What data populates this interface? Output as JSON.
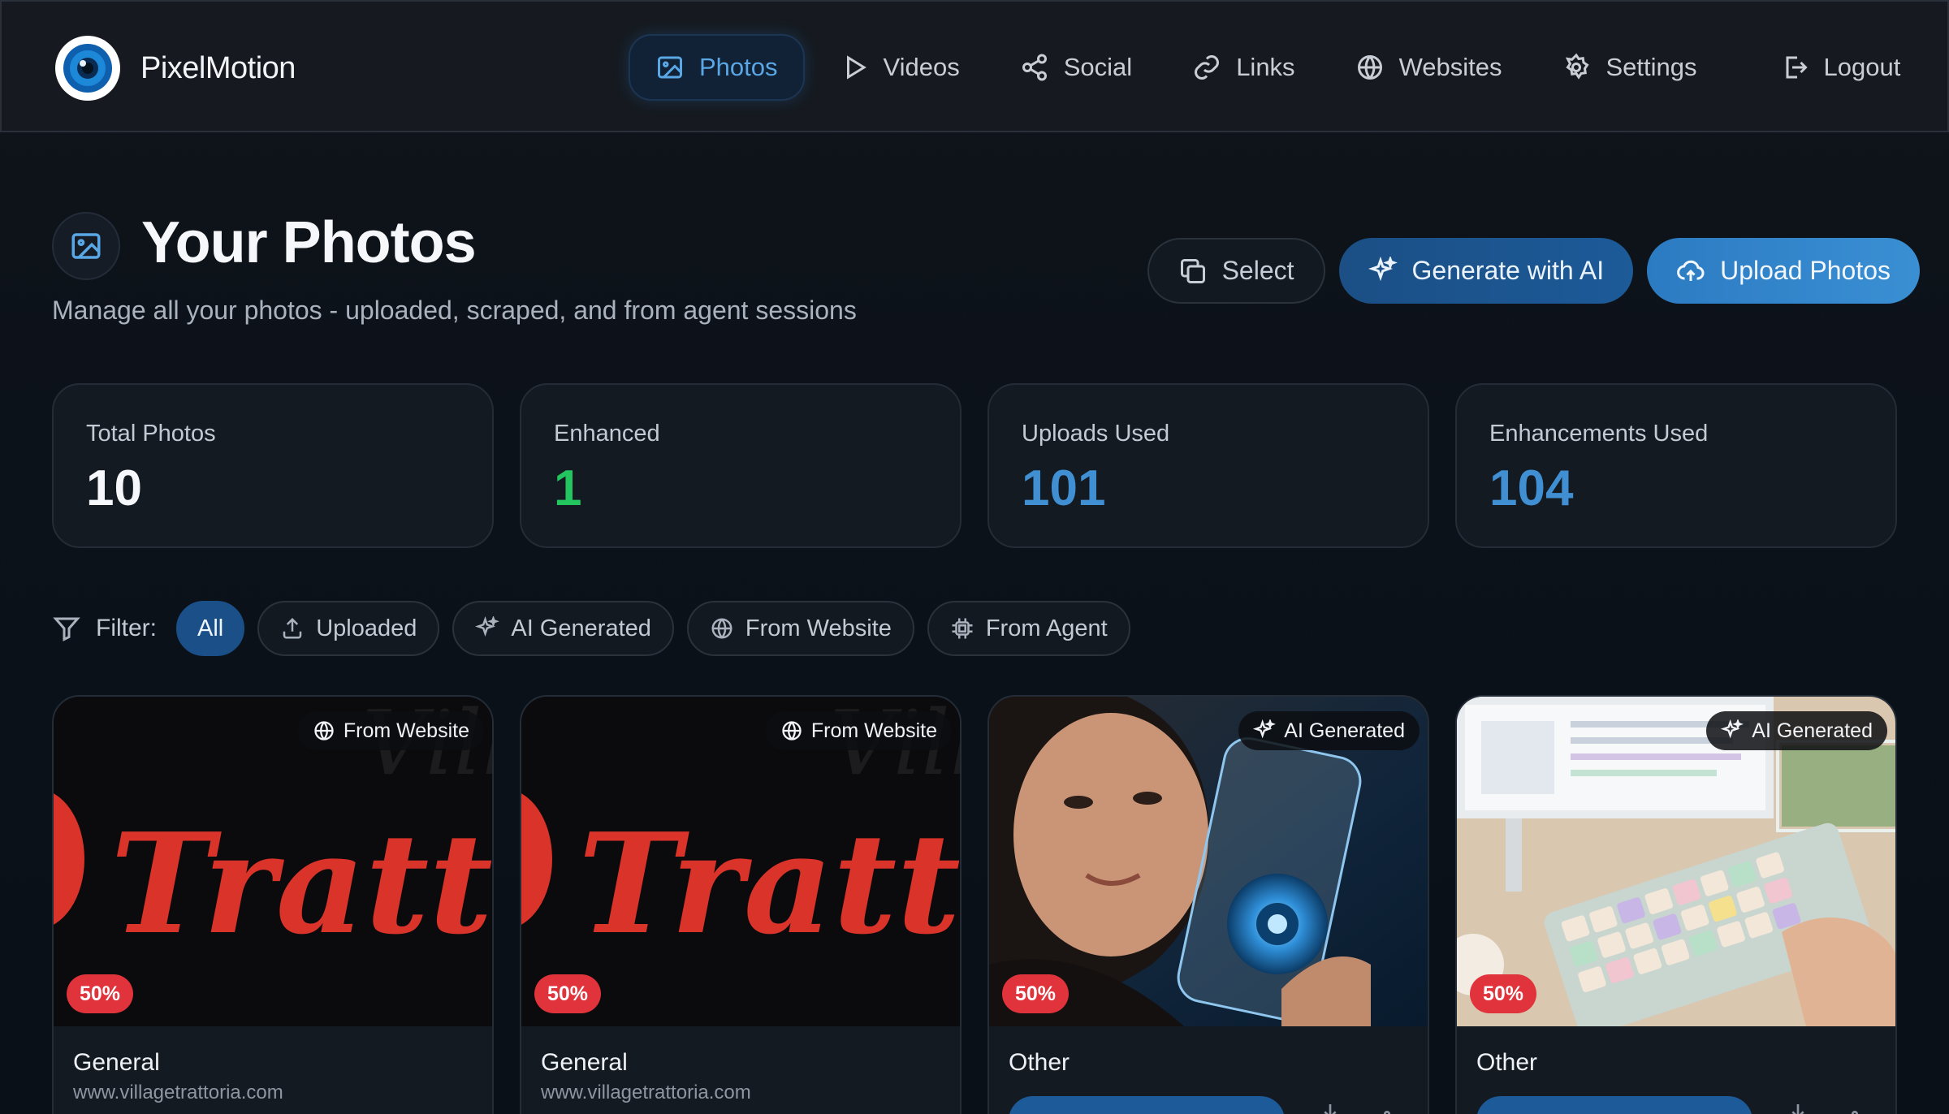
{
  "app": {
    "name": "PixelMotion"
  },
  "nav": {
    "items": [
      {
        "label": "Photos",
        "icon": "image-icon",
        "active": true
      },
      {
        "label": "Videos",
        "icon": "play-icon"
      },
      {
        "label": "Social",
        "icon": "share-icon"
      },
      {
        "label": "Links",
        "icon": "link-icon"
      },
      {
        "label": "Websites",
        "icon": "globe-icon"
      },
      {
        "label": "Settings",
        "icon": "gear-icon"
      },
      {
        "label": "Logout",
        "icon": "logout-icon"
      }
    ]
  },
  "header": {
    "title": "Your Photos",
    "subtitle": "Manage all your photos - uploaded, scraped, and from agent sessions",
    "buttons": {
      "select": "Select",
      "generate": "Generate with AI",
      "upload": "Upload Photos"
    }
  },
  "stats": [
    {
      "label": "Total Photos",
      "value": "10",
      "color": "#f5f7fa"
    },
    {
      "label": "Enhanced",
      "value": "1",
      "color": "#22c55e"
    },
    {
      "label": "Uploads Used",
      "value": "101",
      "color": "#3f8fd2"
    },
    {
      "label": "Enhancements Used",
      "value": "104",
      "color": "#3f8fd2"
    }
  ],
  "filters": {
    "label": "Filter:",
    "options": [
      {
        "label": "All",
        "active": true
      },
      {
        "label": "Uploaded",
        "icon": "upload-icon"
      },
      {
        "label": "AI Generated",
        "icon": "sparkles-icon"
      },
      {
        "label": "From Website",
        "icon": "globe-icon"
      },
      {
        "label": "From Agent",
        "icon": "cpu-icon"
      }
    ]
  },
  "photos": [
    {
      "source": "From Website",
      "score": "50%",
      "category": "General",
      "url": "www.villagetrattoria.com",
      "image_text": "Trattoria"
    },
    {
      "source": "From Website",
      "score": "50%",
      "category": "General",
      "url": "www.villagetrattoria.com",
      "image_text": "Trattoria"
    },
    {
      "source": "AI Generated",
      "score": "50%",
      "category": "Other"
    },
    {
      "source": "AI Generated",
      "score": "50%",
      "category": "Other"
    }
  ],
  "colors": {
    "accent": "#3f8fd2",
    "accent_dark": "#1b4f85",
    "danger": "#e0333b",
    "success": "#22c55e",
    "background": "#0b1119"
  }
}
